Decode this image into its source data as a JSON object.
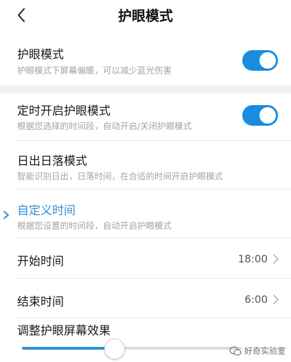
{
  "header": {
    "title": "护眼模式",
    "back_icon": "chevron-left-icon"
  },
  "eye_mode": {
    "title": "护眼模式",
    "subtitle": "护眼模式下屏幕偏暖，可以减少蓝光伤害",
    "enabled": true
  },
  "schedule": {
    "title": "定时开启护眼模式",
    "subtitle": "根据您选择的时间段，自动开启/关闭护眼模式",
    "enabled": true
  },
  "sunrise": {
    "title": "日出日落模式",
    "subtitle": "智能识别日出，日落时间，在合适的时间开启护眼模式"
  },
  "custom": {
    "title": "自定义时间",
    "subtitle": "根据您设置的时间段，自动开启护眼模式",
    "selected": true
  },
  "start_time": {
    "label": "开始时间",
    "value": "18:00"
  },
  "end_time": {
    "label": "结束时间",
    "value": "6:00"
  },
  "effect": {
    "label": "调整护眼屏幕效果",
    "level": 0.42
  },
  "watermark": {
    "text": "好奇实验室"
  },
  "colors": {
    "accent": "#1a8ce0",
    "text_blue": "#2a8fd8",
    "gray": "#a3a3a3"
  }
}
